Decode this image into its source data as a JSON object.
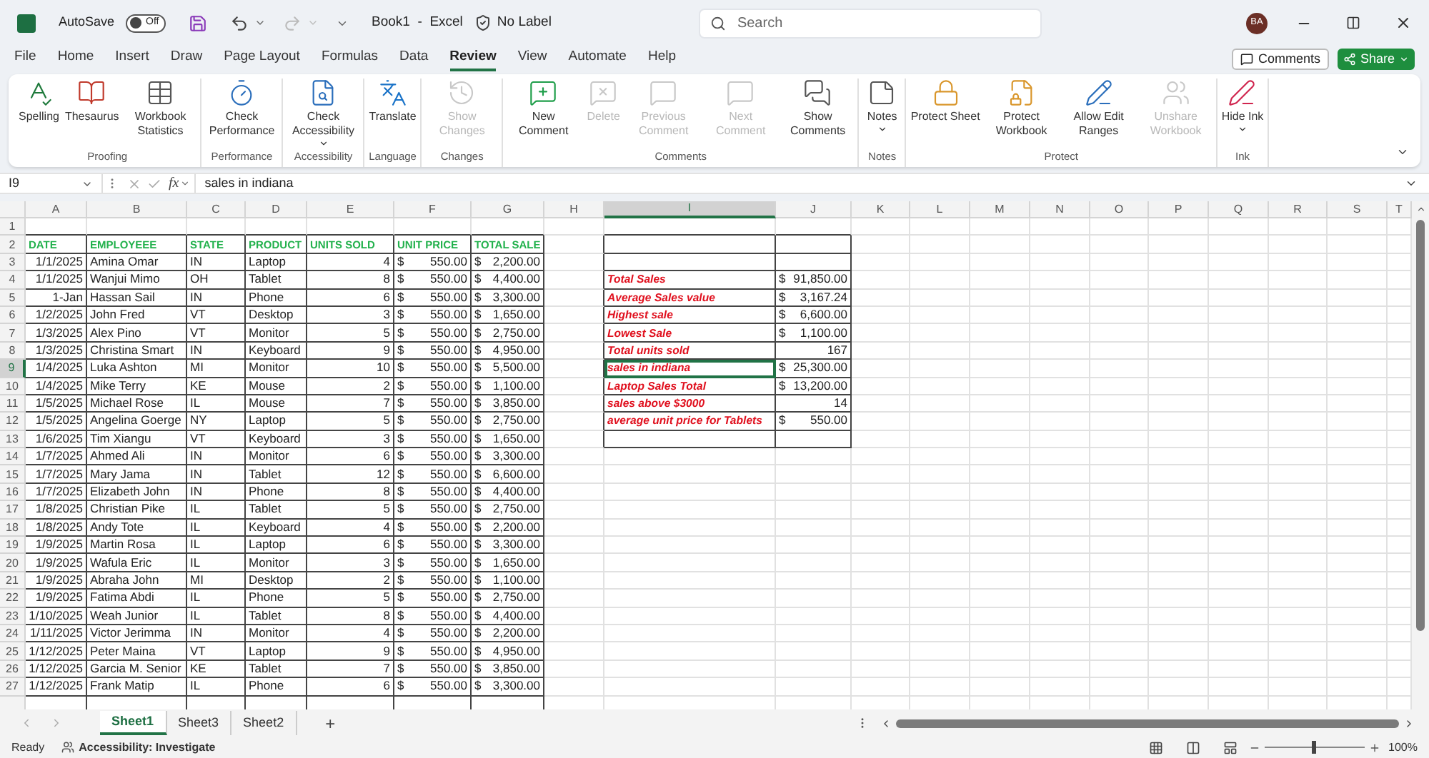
{
  "titlebar": {
    "autosave": "AutoSave",
    "autosave_toggle": {
      "label": "Off",
      "on": false
    },
    "document": "Book1  -  Excel",
    "sensitivity": "No Label",
    "search": {
      "placeholder": "Search"
    },
    "avatar": "BA"
  },
  "menu": [
    {
      "label": "File",
      "selected": false
    },
    {
      "label": "Home",
      "selected": false
    },
    {
      "label": "Insert",
      "selected": false
    },
    {
      "label": "Draw",
      "selected": false
    },
    {
      "label": "Page Layout",
      "selected": false
    },
    {
      "label": "Formulas",
      "selected": false
    },
    {
      "label": "Data",
      "selected": false
    },
    {
      "label": "Review",
      "selected": true
    },
    {
      "label": "View",
      "selected": false
    },
    {
      "label": "Automate",
      "selected": false
    },
    {
      "label": "Help",
      "selected": false
    }
  ],
  "comments_button": "Comments",
  "share_button": "Share",
  "ribbon": {
    "groups": [
      {
        "name": "Proofing",
        "buttons": [
          {
            "label": "Spelling",
            "disabled": false
          },
          {
            "label": "Thesaurus",
            "disabled": false
          },
          {
            "label": "Workbook Statistics",
            "disabled": false
          }
        ]
      },
      {
        "name": "Performance",
        "buttons": [
          {
            "label": "Check Performance",
            "disabled": false
          }
        ]
      },
      {
        "name": "Accessibility",
        "buttons": [
          {
            "label": "Check Accessibility",
            "disabled": false,
            "dropdown": true
          }
        ]
      },
      {
        "name": "Language",
        "buttons": [
          {
            "label": "Translate",
            "disabled": false
          }
        ]
      },
      {
        "name": "Changes",
        "buttons": [
          {
            "label": "Show Changes",
            "disabled": true
          }
        ]
      },
      {
        "name": "Comments",
        "buttons": [
          {
            "label": "New Comment",
            "disabled": false
          },
          {
            "label": "Delete",
            "disabled": true
          },
          {
            "label": "Previous Comment",
            "disabled": true
          },
          {
            "label": "Next Comment",
            "disabled": true
          },
          {
            "label": "Show Comments",
            "disabled": false
          }
        ]
      },
      {
        "name": "Notes",
        "buttons": [
          {
            "label": "Notes",
            "disabled": false,
            "dropdown": true
          }
        ]
      },
      {
        "name": "Protect",
        "buttons": [
          {
            "label": "Protect Sheet",
            "disabled": false
          },
          {
            "label": "Protect Workbook",
            "disabled": false
          },
          {
            "label": "Allow Edit Ranges",
            "disabled": false
          },
          {
            "label": "Unshare Workbook",
            "disabled": true
          }
        ]
      },
      {
        "name": "Ink",
        "buttons": [
          {
            "label": "Hide Ink",
            "disabled": false,
            "dropdown": true
          }
        ]
      }
    ]
  },
  "formula_bar": {
    "name_box": "I9",
    "function_label": "fx",
    "formula": "sales in indiana"
  },
  "columns": [
    {
      "label": "A",
      "selected": false
    },
    {
      "label": "B",
      "selected": false
    },
    {
      "label": "C",
      "selected": false
    },
    {
      "label": "D",
      "selected": false
    },
    {
      "label": "E",
      "selected": false
    },
    {
      "label": "F",
      "selected": false
    },
    {
      "label": "G",
      "selected": false
    },
    {
      "label": "H",
      "selected": false
    },
    {
      "label": "I",
      "selected": true
    },
    {
      "label": "J",
      "selected": false
    },
    {
      "label": "K",
      "selected": false
    },
    {
      "label": "L",
      "selected": false
    },
    {
      "label": "M",
      "selected": false
    },
    {
      "label": "N",
      "selected": false
    },
    {
      "label": "O",
      "selected": false
    },
    {
      "label": "P",
      "selected": false
    },
    {
      "label": "Q",
      "selected": false
    },
    {
      "label": "R",
      "selected": false
    },
    {
      "label": "S",
      "selected": false
    },
    {
      "label": "T",
      "selected": false
    }
  ],
  "rows": [
    {
      "num": "1",
      "selected": false,
      "kind": "empty"
    },
    {
      "num": "2",
      "selected": false,
      "kind": "header",
      "cells": [
        "DATE",
        "EMPLOYEEE",
        "STATE",
        "PRODUCT",
        "UNITS SOLD",
        "UNIT PRICE",
        "TOTAL SALE"
      ]
    },
    {
      "num": "3",
      "selected": false,
      "kind": "data",
      "cells": [
        "1/1/2025",
        "Amina Omar",
        "IN",
        "Laptop",
        "4",
        "$",
        "550.00",
        "$",
        "2,200.00"
      ]
    },
    {
      "num": "4",
      "selected": false,
      "kind": "data",
      "cells": [
        "1/1/2025",
        "Wanjui Mimo",
        "OH",
        "Tablet",
        "8",
        "$",
        "550.00",
        "$",
        "4,400.00"
      ]
    },
    {
      "num": "5",
      "selected": false,
      "kind": "data",
      "cells": [
        "1-Jan",
        "Hassan Sail",
        "IN",
        "Phone",
        "6",
        "$",
        "550.00",
        "$",
        "3,300.00"
      ]
    },
    {
      "num": "6",
      "selected": false,
      "kind": "data",
      "cells": [
        "1/2/2025",
        "John Fred",
        "VT",
        "Desktop",
        "3",
        "$",
        "550.00",
        "$",
        "1,650.00"
      ]
    },
    {
      "num": "7",
      "selected": false,
      "kind": "data",
      "cells": [
        "1/3/2025",
        "Alex Pino",
        "VT",
        "Monitor",
        "5",
        "$",
        "550.00",
        "$",
        "2,750.00"
      ]
    },
    {
      "num": "8",
      "selected": false,
      "kind": "data",
      "cells": [
        "1/3/2025",
        "Christina Smart",
        "IN",
        "Keyboard",
        "9",
        "$",
        "550.00",
        "$",
        "4,950.00"
      ]
    },
    {
      "num": "9",
      "selected": true,
      "kind": "data",
      "cells": [
        "1/4/2025",
        "Luka Ashton",
        "MI",
        "Monitor",
        "10",
        "$",
        "550.00",
        "$",
        "5,500.00"
      ]
    },
    {
      "num": "10",
      "selected": false,
      "kind": "data",
      "cells": [
        "1/4/2025",
        "Mike Terry",
        "KE",
        "Mouse",
        "2",
        "$",
        "550.00",
        "$",
        "1,100.00"
      ]
    },
    {
      "num": "11",
      "selected": false,
      "kind": "data",
      "cells": [
        "1/5/2025",
        "Michael Rose",
        "IL",
        "Mouse",
        "7",
        "$",
        "550.00",
        "$",
        "3,850.00"
      ]
    },
    {
      "num": "12",
      "selected": false,
      "kind": "data",
      "cells": [
        "1/5/2025",
        "Angelina Goerge",
        "NY",
        "Laptop",
        "5",
        "$",
        "550.00",
        "$",
        "2,750.00"
      ]
    },
    {
      "num": "13",
      "selected": false,
      "kind": "data",
      "cells": [
        "1/6/2025",
        "Tim Xiangu",
        "VT",
        "Keyboard",
        "3",
        "$",
        "550.00",
        "$",
        "1,650.00"
      ]
    },
    {
      "num": "14",
      "selected": false,
      "kind": "data",
      "cells": [
        "1/7/2025",
        "Ahmed Ali",
        "IN",
        "Monitor",
        "6",
        "$",
        "550.00",
        "$",
        "3,300.00"
      ]
    },
    {
      "num": "15",
      "selected": false,
      "kind": "data",
      "cells": [
        "1/7/2025",
        "Mary Jama",
        "IN",
        "Tablet",
        "12",
        "$",
        "550.00",
        "$",
        "6,600.00"
      ]
    },
    {
      "num": "16",
      "selected": false,
      "kind": "data",
      "cells": [
        "1/7/2025",
        "Elizabeth John",
        "IN",
        "Phone",
        "8",
        "$",
        "550.00",
        "$",
        "4,400.00"
      ]
    },
    {
      "num": "17",
      "selected": false,
      "kind": "data",
      "cells": [
        "1/8/2025",
        "Christian Pike",
        "IL",
        "Tablet",
        "5",
        "$",
        "550.00",
        "$",
        "2,750.00"
      ]
    },
    {
      "num": "18",
      "selected": false,
      "kind": "data",
      "cells": [
        "1/8/2025",
        "Andy Tote",
        "IL",
        "Keyboard",
        "4",
        "$",
        "550.00",
        "$",
        "2,200.00"
      ]
    },
    {
      "num": "19",
      "selected": false,
      "kind": "data",
      "cells": [
        "1/9/2025",
        "Martin Rosa",
        "IL",
        "Laptop",
        "6",
        "$",
        "550.00",
        "$",
        "3,300.00"
      ]
    },
    {
      "num": "20",
      "selected": false,
      "kind": "data",
      "cells": [
        "1/9/2025",
        "Wafula Eric",
        "IL",
        "Monitor",
        "3",
        "$",
        "550.00",
        "$",
        "1,650.00"
      ]
    },
    {
      "num": "21",
      "selected": false,
      "kind": "data",
      "cells": [
        "1/9/2025",
        "Abraha John",
        "MI",
        "Desktop",
        "2",
        "$",
        "550.00",
        "$",
        "1,100.00"
      ]
    },
    {
      "num": "22",
      "selected": false,
      "kind": "data",
      "cells": [
        "1/9/2025",
        "Fatima Abdi",
        "IL",
        "Phone",
        "5",
        "$",
        "550.00",
        "$",
        "2,750.00"
      ]
    },
    {
      "num": "23",
      "selected": false,
      "kind": "data",
      "cells": [
        "1/10/2025",
        "Weah Junior",
        "IL",
        "Tablet",
        "8",
        "$",
        "550.00",
        "$",
        "4,400.00"
      ]
    },
    {
      "num": "24",
      "selected": false,
      "kind": "data",
      "cells": [
        "1/11/2025",
        "Victor Jerimma",
        "IN",
        "Monitor",
        "4",
        "$",
        "550.00",
        "$",
        "2,200.00"
      ]
    },
    {
      "num": "25",
      "selected": false,
      "kind": "data",
      "cells": [
        "1/12/2025",
        "Peter Maina",
        "VT",
        "Laptop",
        "9",
        "$",
        "550.00",
        "$",
        "4,950.00"
      ]
    },
    {
      "num": "26",
      "selected": false,
      "kind": "data",
      "cells": [
        "1/12/2025",
        "Garcia M. Senior",
        "KE",
        "Tablet",
        "7",
        "$",
        "550.00",
        "$",
        "3,850.00"
      ]
    },
    {
      "num": "27",
      "selected": false,
      "kind": "data",
      "cells": [
        "1/12/2025",
        "Frank Matip",
        "IL",
        "Phone",
        "6",
        "$",
        "550.00",
        "$",
        "3,300.00"
      ]
    }
  ],
  "summary": [
    {
      "label": "Total Sales",
      "currency": "$",
      "amount": "91,850.00",
      "selected": false
    },
    {
      "label": "Average Sales value",
      "currency": "$",
      "amount": "3,167.24",
      "selected": false
    },
    {
      "label": "Highest sale",
      "currency": "$",
      "amount": "6,600.00",
      "selected": false
    },
    {
      "label": "Lowest Sale",
      "currency": "$",
      "amount": "1,100.00",
      "selected": false
    },
    {
      "label": "Total units sold",
      "amount": "167",
      "selected": false
    },
    {
      "label": "sales in indiana",
      "currency": "$",
      "amount": "25,300.00",
      "selected": true
    },
    {
      "label": "Laptop Sales Total",
      "currency": "$",
      "amount": "13,200.00",
      "selected": false
    },
    {
      "label": "sales above $3000",
      "amount": "14",
      "selected": false
    },
    {
      "label": "average unit price for Tablets",
      "currency": "$",
      "amount": "550.00",
      "selected": false
    }
  ],
  "sheets": [
    {
      "label": "Sheet1",
      "selected": true
    },
    {
      "label": "Sheet3",
      "selected": false
    },
    {
      "label": "Sheet2",
      "selected": false
    }
  ],
  "add_sheet": "+",
  "status": {
    "ready": "Ready",
    "accessibility": "Accessibility: Investigate",
    "zoom": {
      "level": 0.5,
      "reading": "100%"
    }
  }
}
